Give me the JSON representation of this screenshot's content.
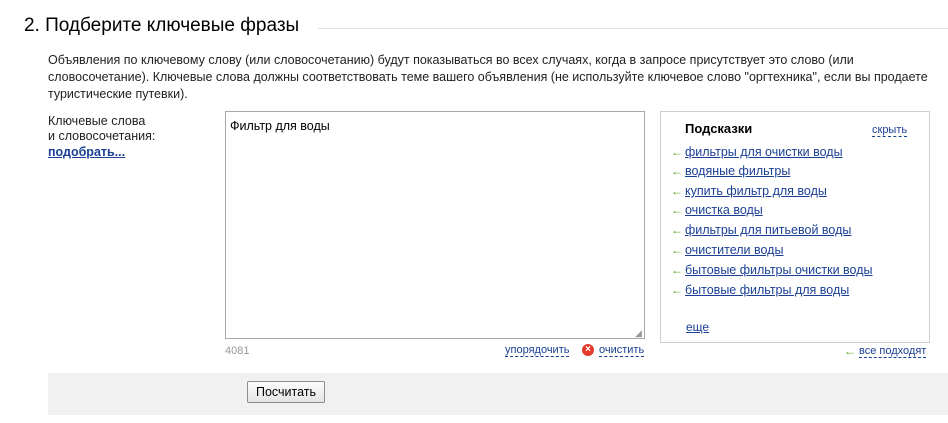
{
  "section": {
    "title": "2. Подберите ключевые фразы",
    "description": "Объявления по ключевому слову (или словосочетанию) будут показываться во всех случаях, когда в запросе присутствует это слово (или словосочетание). Ключевые слова должны соответствовать теме вашего объявления (не используйте ключевое слово \"оргтехника\", если вы продаете туристические путевки)."
  },
  "keywords": {
    "label_line1": "Ключевые слова",
    "label_line2": "и словосочетания:",
    "pick_link": "подобрать...",
    "value": "Фильтр для воды",
    "counter": "4081",
    "sort_link": "упорядочить",
    "clear_link": "очистить"
  },
  "hints": {
    "title": "Подсказки",
    "hide_link": "скрыть",
    "items": [
      "фильтры для очистки воды",
      "водяные фильтры",
      "купить фильтр для воды",
      "очистка воды",
      "фильтры для питьевой воды",
      "очистители воды",
      "бытовые фильтры очистки воды",
      "бытовые фильтры для воды"
    ],
    "more_link": "еще",
    "all_fit_link": "все подходят"
  },
  "actions": {
    "calculate_button": "Посчитать"
  },
  "icons": {
    "hint_arrow": "arrow-left-icon",
    "clear": "clear-x-icon"
  },
  "colors": {
    "link": "#1a3f95",
    "arrow": "#5aa51f",
    "clear_icon": "#e23b2e",
    "bar_bg": "#f1f1f1"
  }
}
